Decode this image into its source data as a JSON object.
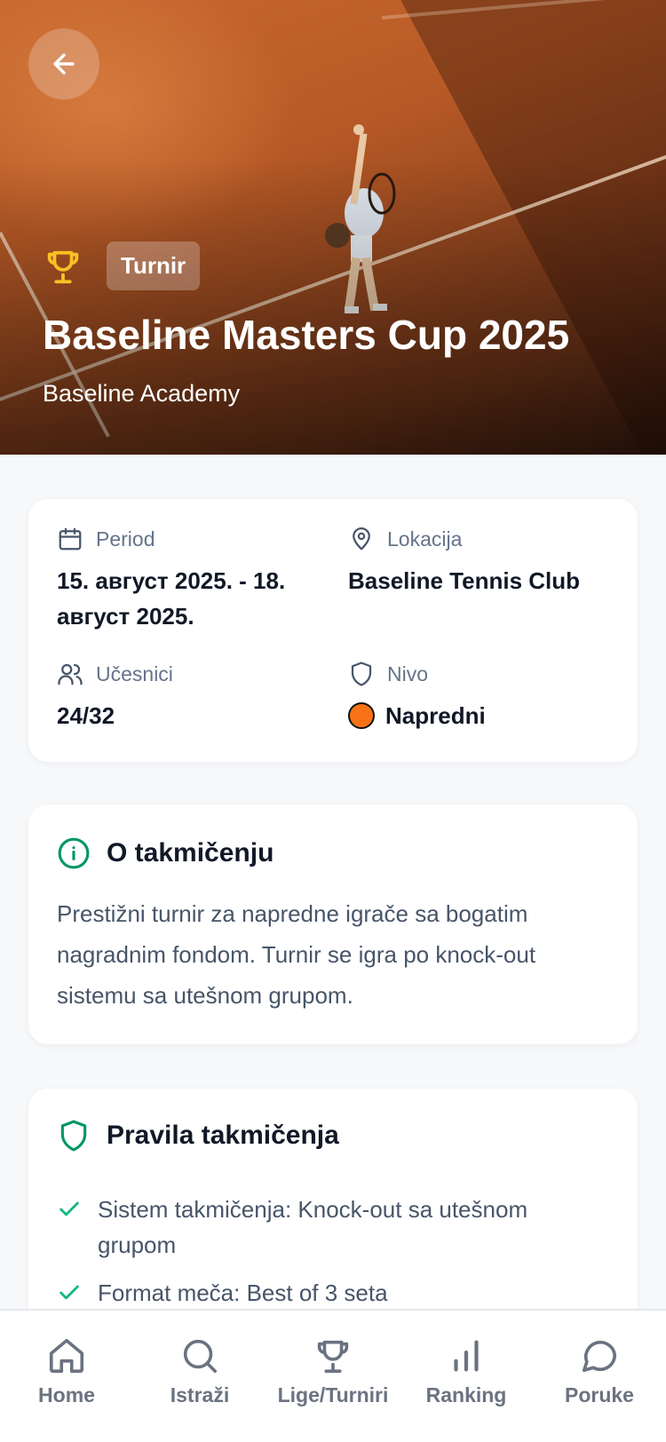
{
  "hero": {
    "badge": "Turnir",
    "title": "Baseline Masters Cup 2025",
    "organizer": "Baseline Academy"
  },
  "details": {
    "period": {
      "label": "Period",
      "value": "15. август 2025. - 18. август 2025."
    },
    "location": {
      "label": "Lokacija",
      "value": "Baseline Tennis Club"
    },
    "participants": {
      "label": "Učesnici",
      "value": "24/32"
    },
    "level": {
      "label": "Nivo",
      "value": "Napredni",
      "color": "#f97316"
    }
  },
  "about": {
    "title": "O takmičenju",
    "text": "Prestižni turnir za napredne igrače sa bogatim nagradnim fondom. Turnir se igra po knock-out sistemu sa utešnom grupom."
  },
  "rules": {
    "title": "Pravila takmičenja",
    "items": [
      "Sistem takmičenja: Knock-out sa utešnom grupom",
      "Format meča: Best of 3 seta"
    ]
  },
  "nav": {
    "items": [
      {
        "label": "Home",
        "icon": "home-icon"
      },
      {
        "label": "Istraži",
        "icon": "search-icon"
      },
      {
        "label": "Lige/Turniri",
        "icon": "trophy-icon"
      },
      {
        "label": "Ranking",
        "icon": "bar-chart-icon"
      },
      {
        "label": "Poruke",
        "icon": "chat-icon"
      }
    ]
  },
  "colors": {
    "accent_green": "#059669",
    "trophy_yellow": "#fbbf24",
    "level_orange": "#f97316"
  }
}
